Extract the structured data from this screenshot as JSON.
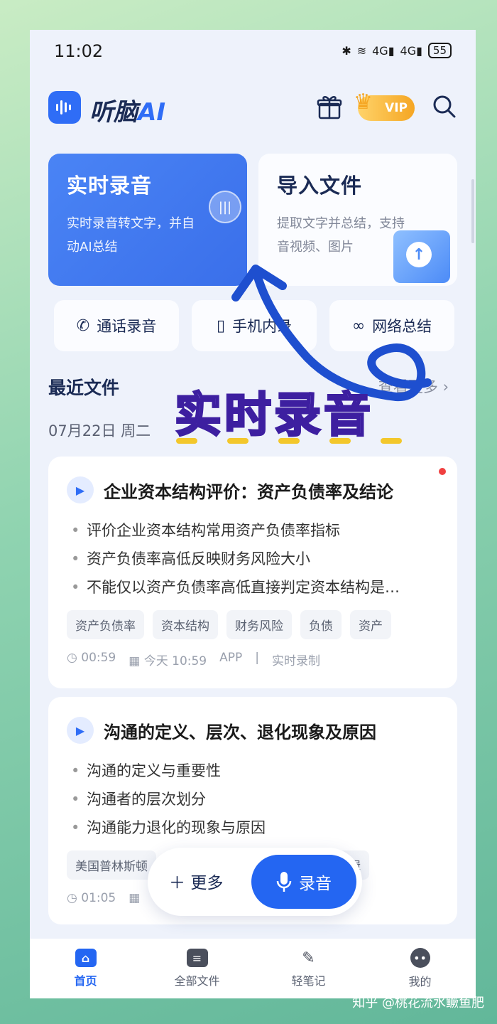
{
  "status": {
    "time": "11:02",
    "signal_1": "4G",
    "signal_2": "4G",
    "battery": "55"
  },
  "header": {
    "brand_main": "听脑",
    "brand_ai": "AI",
    "vip_label": "VIP"
  },
  "cards": {
    "record": {
      "title": "实时录音",
      "desc": "实时录音转文字，并自动AI总结"
    },
    "import": {
      "title": "导入文件",
      "desc": "提取文字并总结，支持音视频、图片"
    }
  },
  "chips": [
    {
      "label": "通话录音"
    },
    {
      "label": "手机内录"
    },
    {
      "label": "网络总结"
    }
  ],
  "recent": {
    "title": "最近文件",
    "more": "查看更多",
    "date": "07月22日 周二"
  },
  "files": [
    {
      "title": "企业资本结构评价：资产负债率及结论",
      "bullets": [
        "评价企业资本结构常用资产负债率指标",
        "资产负债率高低反映财务风险大小",
        "不能仅以资产负债率高低直接判定资本结构是…"
      ],
      "tags": [
        "资产负债率",
        "资本结构",
        "财务风险",
        "负债",
        "资产"
      ],
      "duration": "00:59",
      "time": "今天 10:59",
      "source": "APP",
      "sep": "|",
      "type": "实时录制"
    },
    {
      "title": "沟通的定义、层次、退化现象及原因",
      "bullets": [
        "沟通的定义与重要性",
        "沟通者的层次划分",
        "沟通能力退化的现象与原因"
      ],
      "tags": [
        "美国普林斯顿",
        "逻辑"
      ],
      "duration": "01:05"
    }
  ],
  "float_bar": {
    "more": "更多",
    "record": "录音"
  },
  "tabs": [
    {
      "label": "首页"
    },
    {
      "label": "全部文件"
    },
    {
      "label": "轻笔记"
    },
    {
      "label": "我的"
    }
  ],
  "overlay": {
    "text": "实时录音"
  },
  "watermark": "知乎 @桃花流水鳜鱼肥",
  "colors": {
    "primary": "#2466f2",
    "overlay_fill": "#b7a8ff",
    "overlay_stroke": "#3d1fa0",
    "arrow": "#1e4fcf"
  }
}
